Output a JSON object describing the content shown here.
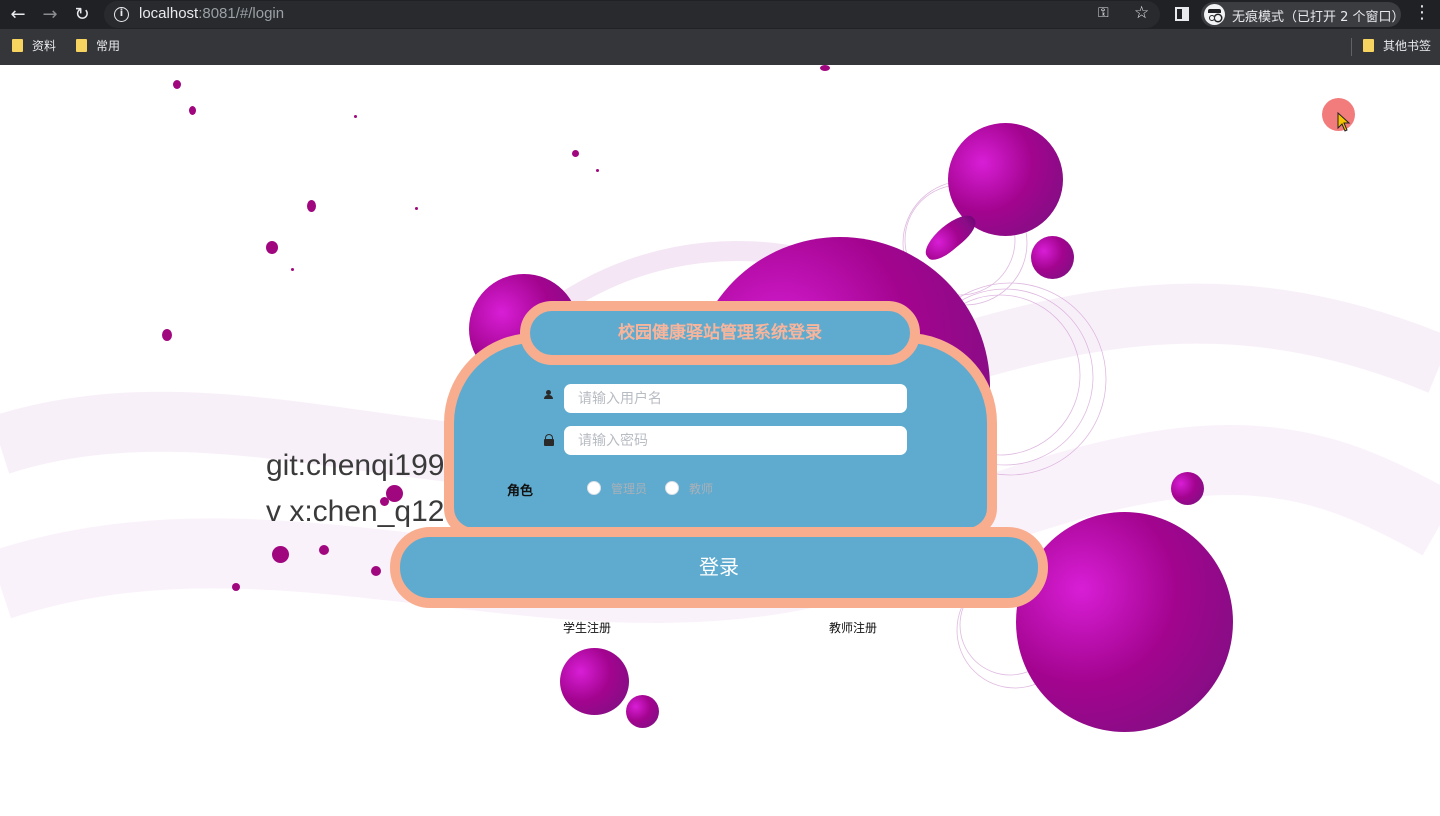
{
  "browser": {
    "url_host": "localhost",
    "url_rest": ":8081/#/login",
    "incognito_label": "无痕模式（已打开 2 个窗口）",
    "bookmarks": [
      "资料",
      "常用"
    ],
    "other_bookmarks": "其他书签"
  },
  "login": {
    "title": "校园健康驿站管理系统登录",
    "username_placeholder": "请输入用户名",
    "password_placeholder": "请输入密码",
    "role_label": "角色",
    "role_options": [
      "管理员",
      "教师"
    ],
    "submit_label": "登录",
    "register_links": [
      "学生注册",
      "教师注册"
    ]
  },
  "watermark": {
    "line1": "git:chenqi199",
    "line2": "v x:chen_q123456"
  },
  "colors": {
    "card_fill": "#5fabcf",
    "card_border": "#f8ad8f",
    "sphere": "#a3048f"
  }
}
